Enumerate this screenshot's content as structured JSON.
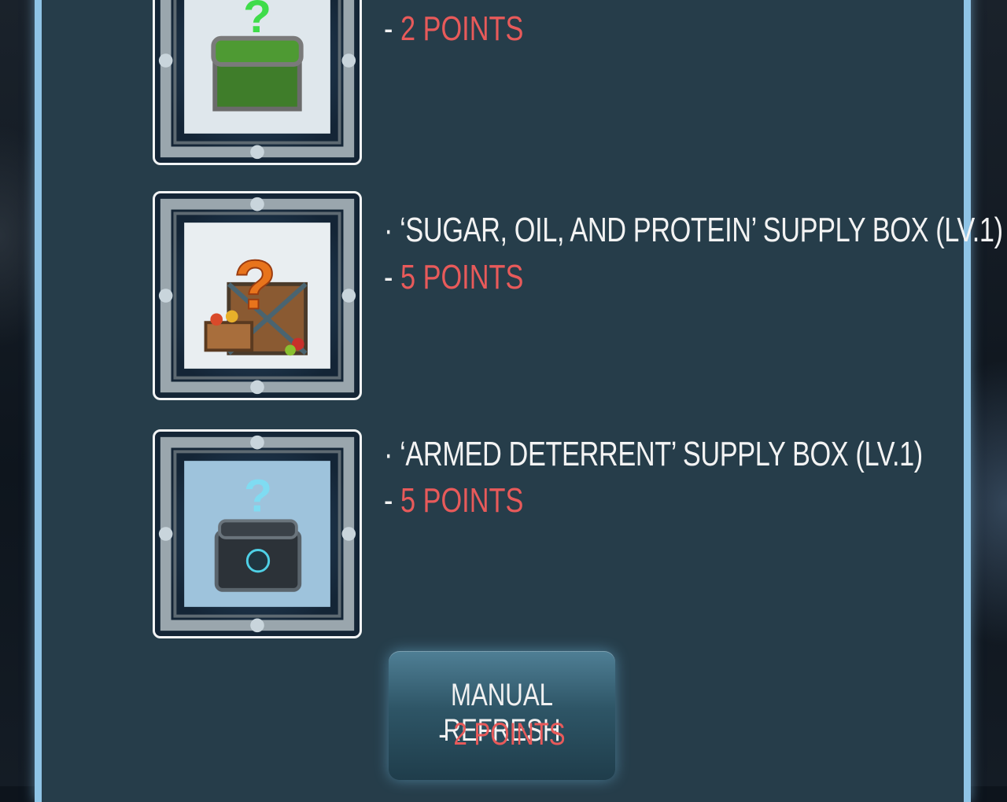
{
  "items": [
    {
      "name": "",
      "dash": "- ",
      "cost": "2 POINTS",
      "icon": "green-supply-box-icon"
    },
    {
      "name": "· ‘SUGAR, OIL, AND PROTEIN’ SUPPLY BOX (LV.1)",
      "dash": "- ",
      "cost": "5 POINTS",
      "icon": "food-supply-box-icon"
    },
    {
      "name": "· ‘ARMED DETERRENT’ SUPPLY BOX (LV.1)",
      "dash": "- ",
      "cost": "5 POINTS",
      "icon": "armed-supply-box-icon"
    }
  ],
  "refresh": {
    "label": "MANUAL REFRESH",
    "dash": "- ",
    "cost": "2 POINTS"
  },
  "colors": {
    "panel": "#263d4a",
    "border": "#8fc4e6",
    "cost": "#e85a5a",
    "text": "#f3f3f3"
  }
}
